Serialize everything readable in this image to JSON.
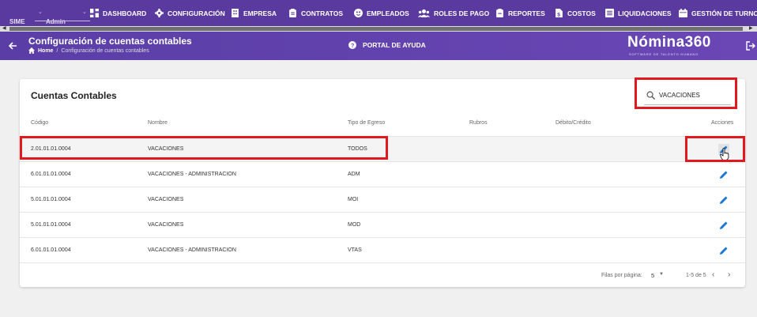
{
  "topnav": {
    "company": "SIME",
    "user": "Admin",
    "items": [
      {
        "label": "DASHBOARD",
        "icon": "dashboard-icon"
      },
      {
        "label": "CONFIGURACIÓN",
        "icon": "gear-icon"
      },
      {
        "label": "EMPRESA",
        "icon": "building-icon"
      },
      {
        "label": "CONTRATOS",
        "icon": "contract-icon"
      },
      {
        "label": "EMPLEADOS",
        "icon": "employee-icon"
      },
      {
        "label": "ROLES DE PAGO",
        "icon": "users-icon"
      },
      {
        "label": "REPORTES",
        "icon": "report-icon"
      },
      {
        "label": "COSTOS",
        "icon": "file-dollar-icon"
      },
      {
        "label": "LIQUIDACIONES",
        "icon": "list-icon"
      },
      {
        "label": "GESTIÓN DE TURNOS",
        "icon": "calendar-icon"
      }
    ]
  },
  "header": {
    "title": "Configuración de cuentas contables",
    "breadcrumb_home": "Home",
    "breadcrumb_current": "Configuración de cuentas contables",
    "help": "PORTAL DE AYUDA",
    "logo": "Nómina360",
    "logo_sub": "SOFTWARE DE TALENTO HUMANO"
  },
  "card": {
    "title": "Cuentas Contables",
    "search_value": "VACACIONES",
    "columns": [
      "Código",
      "Nombre",
      "Tipo de Egreso",
      "Rubros",
      "Débito/Crédito",
      "Acciones"
    ],
    "rows": [
      {
        "codigo": "2.01.01.01.0004",
        "nombre": "VACACIONES",
        "tipo": "TODOS",
        "rubros": "",
        "debito": ""
      },
      {
        "codigo": "6.01.01.01.0004",
        "nombre": "VACACIONES - ADMINISTRACION",
        "tipo": "ADM",
        "rubros": "",
        "debito": ""
      },
      {
        "codigo": "5.01.01.01.0004",
        "nombre": "VACACIONES",
        "tipo": "MOI",
        "rubros": "",
        "debito": ""
      },
      {
        "codigo": "5.01.01.01.0004",
        "nombre": "VACACIONES",
        "tipo": "MOD",
        "rubros": "",
        "debito": ""
      },
      {
        "codigo": "6.01.01.01.0004",
        "nombre": "VACACIONES - ADMINISTRACION",
        "tipo": "VTAS",
        "rubros": "",
        "debito": ""
      }
    ],
    "footer": {
      "rows_per_page_label": "Filas por página:",
      "rows_per_page": "5",
      "range": "1-5 de 5"
    }
  },
  "colors": {
    "nav": "#5b3aa0",
    "header": "#6a47b5",
    "accent_blue": "#1976d2",
    "highlight_red": "#e0191f"
  }
}
